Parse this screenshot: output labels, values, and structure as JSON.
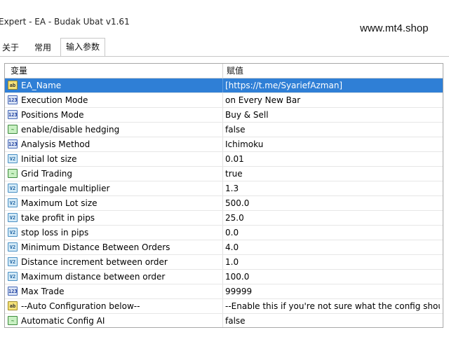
{
  "window": {
    "title": "Expert - EA - Budak Ubat v1.61",
    "watermark": "www.mt4.shop"
  },
  "tabs": [
    {
      "label": "关于",
      "active": false
    },
    {
      "label": "常用",
      "active": false
    },
    {
      "label": "输入参数",
      "active": true
    }
  ],
  "grid": {
    "columns": [
      "变量",
      "赋值"
    ],
    "rows": [
      {
        "icon": "ab",
        "name": "EA_Name",
        "value": "[https://t.me/SyariefAzman]",
        "selected": true
      },
      {
        "icon": "123",
        "name": "Execution Mode",
        "value": "on Every New Bar"
      },
      {
        "icon": "123",
        "name": "Positions Mode",
        "value": "Buy & Sell"
      },
      {
        "icon": "bool",
        "name": "enable/disable hedging",
        "value": "false"
      },
      {
        "icon": "123",
        "name": "Analysis Method",
        "value": "Ichimoku"
      },
      {
        "icon": "dbl",
        "name": "Initial lot size",
        "value": "0.01"
      },
      {
        "icon": "bool",
        "name": "Grid Trading",
        "value": "true"
      },
      {
        "icon": "dbl",
        "name": "martingale multiplier",
        "value": "1.3"
      },
      {
        "icon": "dbl",
        "name": "Maximum Lot size",
        "value": "500.0"
      },
      {
        "icon": "dbl",
        "name": "take profit in pips",
        "value": "25.0"
      },
      {
        "icon": "dbl",
        "name": "stop loss in pips",
        "value": "0.0"
      },
      {
        "icon": "dbl",
        "name": "Minimum Distance Between Orders",
        "value": "4.0"
      },
      {
        "icon": "dbl",
        "name": "Distance increment between order",
        "value": "1.0"
      },
      {
        "icon": "dbl",
        "name": "Maximum distance between order",
        "value": "100.0"
      },
      {
        "icon": "123",
        "name": "Max Trade",
        "value": "99999"
      },
      {
        "icon": "ab",
        "name": "--Auto Configuration below--",
        "value": "--Enable this if you're not sure what the config shoul..."
      },
      {
        "icon": "bool",
        "name": "Automatic Config AI",
        "value": "false"
      }
    ]
  },
  "icon_glyphs": {
    "ab": "ab",
    "123": "123",
    "bool": "~",
    "dbl": "V2"
  },
  "colors": {
    "selection": "#2f7fd6",
    "border": "#a8a8a8"
  }
}
